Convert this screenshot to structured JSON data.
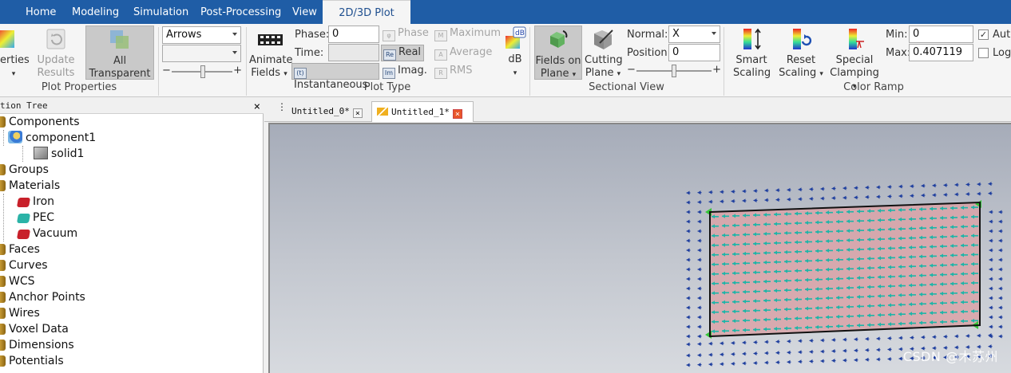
{
  "menu": {
    "tabs": [
      "Home",
      "Modeling",
      "Simulation",
      "Post-Processing",
      "View",
      "2D/3D Plot"
    ],
    "active": "2D/3D Plot"
  },
  "ribbon": {
    "plot_properties": {
      "label": "Plot Properties",
      "properties_partial": "erties",
      "update_results": [
        "Update",
        "Results"
      ],
      "all_transparent": [
        "All",
        "Transparent"
      ],
      "plot_mode_select": "Arrows",
      "second_select": "",
      "slider_minus": "−",
      "slider_plus": "+"
    },
    "plot_type": {
      "label": "Plot Type",
      "animate_fields": [
        "Animate",
        "Fields"
      ],
      "phase_label": "Phase:",
      "phase_value": "0",
      "time_label": "Time:",
      "time_value": "",
      "instantaneous": "Instantaneous",
      "phase_opt": "Phase",
      "real_opt": "Real",
      "imag_opt": "Imag.",
      "maximum_opt": "Maximum",
      "average_opt": "Average",
      "rms_opt": "RMS",
      "db_label": "dB",
      "db_icon_text": "dB"
    },
    "sectional_view": {
      "label": "Sectional View",
      "fields_on_plane": [
        "Fields on",
        "Plane"
      ],
      "cutting_plane": [
        "Cutting",
        "Plane"
      ],
      "normal_label": "Normal:",
      "normal_value": "X",
      "position_label": "Position:",
      "position_value": "0",
      "slider_minus": "−",
      "slider_plus": "+"
    },
    "color_ramp": {
      "label": "Color Ramp",
      "smart_scaling": [
        "Smart",
        "Scaling"
      ],
      "reset_scaling": [
        "Reset",
        "Scaling"
      ],
      "special_clamping": [
        "Special",
        "Clamping"
      ],
      "min_label": "Min:",
      "min_value": "0",
      "max_label": "Max:",
      "max_value": "0.407119",
      "auto_label": "Auto",
      "auto_checked": true,
      "log_label": "Log.",
      "log_checked": false
    }
  },
  "tree": {
    "header": "tion Tree",
    "close": "×",
    "items": [
      {
        "label": "Components"
      },
      {
        "label": "component1"
      },
      {
        "label": "solid1"
      },
      {
        "label": "Groups"
      },
      {
        "label": "Materials"
      },
      {
        "label": "Iron",
        "color": "#c8202a"
      },
      {
        "label": "PEC",
        "color": "#2bb3a7"
      },
      {
        "label": "Vacuum",
        "color": "#c8202a"
      },
      {
        "label": "Faces"
      },
      {
        "label": "Curves"
      },
      {
        "label": "WCS"
      },
      {
        "label": "Anchor Points"
      },
      {
        "label": "Wires"
      },
      {
        "label": "Voxel Data"
      },
      {
        "label": "Dimensions"
      },
      {
        "label": "Potentials"
      }
    ]
  },
  "docs": {
    "tabs": [
      {
        "label": "Untitled_0*",
        "close": "×"
      },
      {
        "label": "Untitled_1*",
        "close": "×"
      }
    ],
    "active_index": 1
  },
  "viewport": {
    "watermark": "CSDN @木苏州",
    "arrow_color": "#1db5a8",
    "outer_arrow_color": "#1f3f9f",
    "plane_color": "#d9a3a8"
  }
}
